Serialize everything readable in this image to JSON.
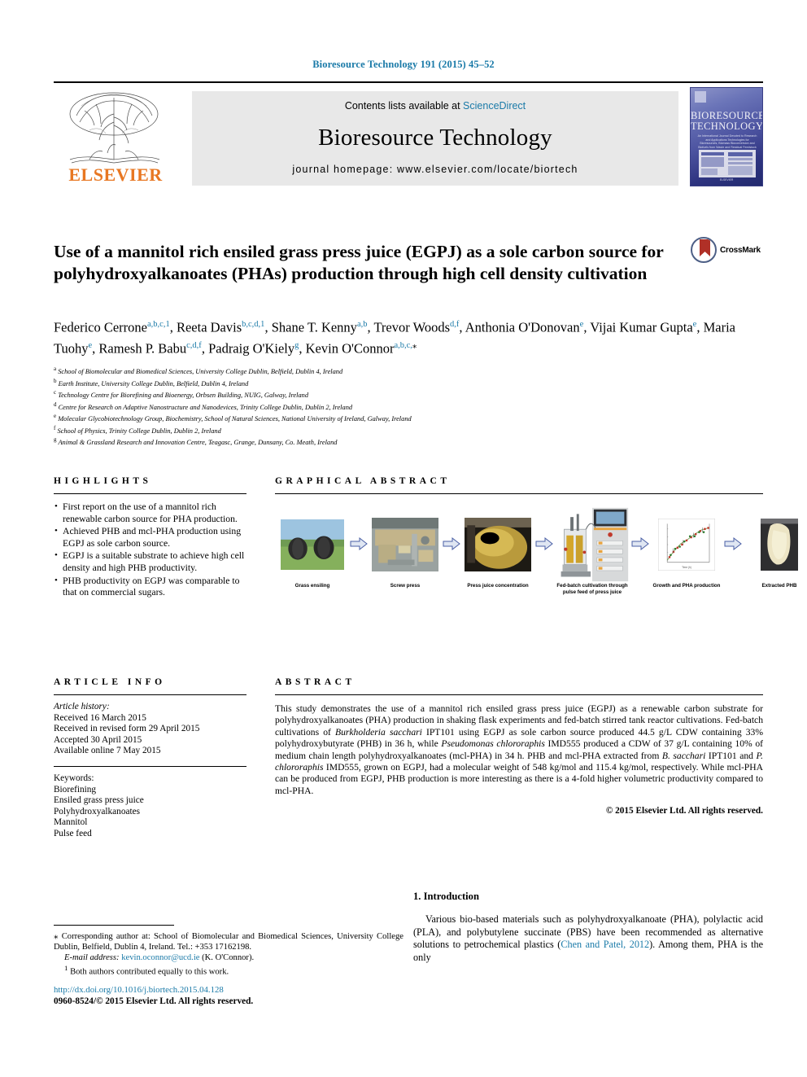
{
  "running_head": "Bioresource Technology 191 (2015) 45–52",
  "masthead": {
    "publisher_name": "ELSEVIER",
    "contents_prefix": "Contents lists available at ",
    "contents_link": "ScienceDirect",
    "journal_title": "Bioresource Technology",
    "homepage": "journal homepage: www.elsevier.com/locate/biortech",
    "cover": {
      "line1": "BIORESOURCE",
      "line2": "TECHNOLOGY",
      "blurb": "An International Journal Devoted to Research and Applications Technologies for Bioresources, Biomass Bioconversion and Biofuels from Waste and Residual Feedstock",
      "footer": "ELSEVIER"
    }
  },
  "article": {
    "title": "Use of a mannitol rich ensiled grass press juice (EGPJ) as a sole carbon source for polyhydroxyalkanoates (PHAs) production through high cell density cultivation",
    "crossmark_label": "CrossMark",
    "authors": [
      {
        "name": "Federico Cerrone",
        "sup": "a,b,c,1",
        "sep": ", "
      },
      {
        "name": "Reeta Davis",
        "sup": "b,c,d,1",
        "sep": ", "
      },
      {
        "name": "Shane T. Kenny",
        "sup": "a,b",
        "sep": ", "
      },
      {
        "name": "Trevor Woods",
        "sup": "d,f",
        "sep": ", "
      },
      {
        "name": "Anthonia O'Donovan",
        "sup": "e",
        "sep": ", "
      },
      {
        "name": "Vijai Kumar Gupta",
        "sup": "e",
        "sep": ", "
      },
      {
        "name": "Maria Tuohy",
        "sup": "e",
        "sep": ", "
      },
      {
        "name": "Ramesh P. Babu",
        "sup": "c,d,f",
        "sep": ", "
      },
      {
        "name": "Padraig O'Kiely",
        "sup": "g",
        "sep": ", "
      },
      {
        "name": "Kevin O'Connor",
        "sup": "a,b,c,",
        "sep": ""
      }
    ],
    "affiliations": [
      {
        "mark": "a",
        "text": "School of Biomolecular and Biomedical Sciences, University College Dublin, Belfield, Dublin 4, Ireland"
      },
      {
        "mark": "b",
        "text": "Earth Institute, University College Dublin, Belfield, Dublin 4, Ireland"
      },
      {
        "mark": "c",
        "text": "Technology Centre for Biorefining and Bioenergy, Orbsen Building, NUIG, Galway, Ireland"
      },
      {
        "mark": "d",
        "text": "Centre for Research on Adaptive Nanostructure and Nanodevices, Trinity College Dublin, Dublin 2, Ireland"
      },
      {
        "mark": "e",
        "text": "Molecular Glycobiotechnology Group, Biochemistry, School of Natural Sciences, National University of Ireland, Galway, Ireland"
      },
      {
        "mark": "f",
        "text": "School of Physics, Trinity College Dublin, Dublin 2, Ireland"
      },
      {
        "mark": "g",
        "text": "Animal & Grassland Research and Innovation Centre, Teagasc, Grange, Dunsany, Co. Meath, Ireland"
      }
    ]
  },
  "highlights": {
    "heading": "HIGHLIGHTS",
    "items": [
      "First report on the use of a mannitol rich renewable carbon source for PHA production.",
      "Achieved PHB and mcl-PHA production using EGPJ as sole carbon source.",
      "EGPJ is a suitable substrate to achieve high cell density and high PHB productivity.",
      "PHB productivity on EGPJ was comparable to that on commercial sugars."
    ]
  },
  "graphical_abstract": {
    "heading": "GRAPHICAL ABSTRACT",
    "steps": [
      {
        "caption": "Grass ensiling",
        "kind": "grass-bales"
      },
      {
        "caption": "Screw press",
        "kind": "screw-press"
      },
      {
        "caption": "Press juice concentration",
        "kind": "press-juice"
      },
      {
        "caption": "Fed-batch cultivation through pulse feed of press juice",
        "kind": "bioreactor"
      },
      {
        "caption": "Growth and PHA production",
        "kind": "growth-plot"
      },
      {
        "caption": "Extracted PHB",
        "kind": "extracted-phb"
      }
    ]
  },
  "article_info": {
    "heading": "ARTICLE INFO",
    "history_label": "Article history:",
    "history": [
      "Received 16 March 2015",
      "Received in revised form 29 April 2015",
      "Accepted 30 April 2015",
      "Available online 7 May 2015"
    ],
    "keywords_label": "Keywords:",
    "keywords": [
      "Biorefining",
      "Ensiled grass press juice",
      "Polyhydroxyalkanoates",
      "Mannitol",
      "Pulse feed"
    ]
  },
  "abstract": {
    "heading": "ABSTRACT",
    "paragraph_1": "This study demonstrates the use of a mannitol rich ensiled grass press juice (EGPJ) as a renewable carbon substrate for polyhydroxyalkanoates (PHA) production in shaking flask experiments and fed-batch stirred tank reactor cultivations. Fed-batch cultivations of ",
    "organism_1": "Burkholderia sacchari",
    "paragraph_2": " IPT101 using EGPJ as sole carbon source produced 44.5 g/L CDW containing 33% polyhydroxybutyrate (PHB) in 36 h, while ",
    "organism_2": "Pseudomonas chlororaphis",
    "paragraph_3": " IMD555 produced a CDW of 37 g/L containing 10% of medium chain length polyhydroxyalkanoates (mcl-PHA) in 34 h. PHB and mcl-PHA extracted from ",
    "organism_3": "B. sacchari",
    "paragraph_4": " IPT101 and ",
    "organism_4": "P. chlororaphis",
    "paragraph_5": " IMD555, grown on EGPJ, had a molecular weight of 548 kg/mol and 115.4 kg/mol, respectively. While mcl-PHA can be produced from EGPJ, PHB production is more interesting as there is a 4-fold higher volumetric productivity compared to mcl-PHA.",
    "copyright": "© 2015 Elsevier Ltd. All rights reserved."
  },
  "introduction": {
    "heading": "1. Introduction",
    "text_1": "Various bio-based materials such as polyhydroxyalkanoate (PHA), polylactic acid (PLA), and polybutylene succinate (PBS) have been recommended as alternative solutions to petrochemical plastics (",
    "citation": "Chen and Patel, 2012",
    "text_2": "). Among them, PHA is the only"
  },
  "footnotes": {
    "corresponding_symbol": "⁎",
    "corresponding": " Corresponding author at: School of Biomolecular and Biomedical Sciences, University College Dublin, Belfield, Dublin 4, Ireland. Tel.: +353 17162198.",
    "email_label": "E-mail address:",
    "email": "kevin.oconnor@ucd.ie",
    "email_suffix": " (K. O'Connor).",
    "equal_symbol": "1",
    "equal_contrib": " Both authors contributed equally to this work."
  },
  "footer": {
    "doi": "http://dx.doi.org/10.1016/j.biortech.2015.04.128",
    "issn_line": "0960-8524/© 2015 Elsevier Ltd. All rights reserved."
  },
  "colors": {
    "link_blue": "#1a7aa8",
    "elsevier_orange": "#E87722",
    "crossmark_red": "#b03027",
    "cover_blue": "#3a3f85"
  }
}
